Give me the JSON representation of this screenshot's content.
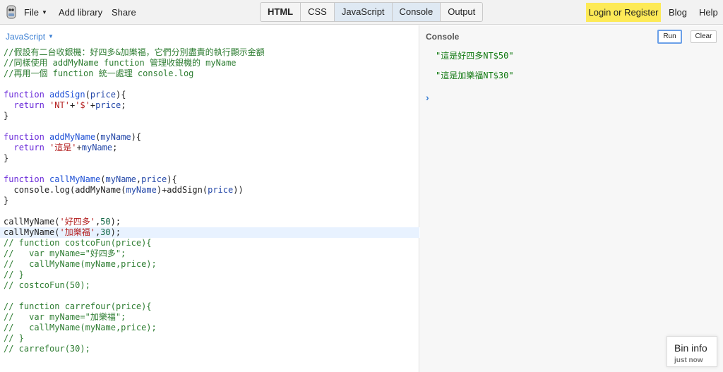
{
  "topbar": {
    "file_label": "File",
    "add_library_label": "Add library",
    "share_label": "Share",
    "tabs": [
      "HTML",
      "CSS",
      "JavaScript",
      "Console",
      "Output"
    ],
    "login_label": "Login or Register",
    "blog_label": "Blog",
    "help_label": "Help",
    "accent_color": "#fdea57"
  },
  "editor": {
    "language_label": "JavaScript",
    "lines": [
      "//假設有二台收銀機：好四多&加樂福，它們分別盡責的執行顯示金額",
      "//同樣使用 addMyName function 管理收銀機的 myName",
      "//再用一個 function 統一處理 console.log",
      "",
      "function addSign(price){",
      "  return 'NT'+'$'+price;",
      "}",
      "",
      "function addMyName(myName){",
      "  return '這是'+myName;",
      "}",
      "",
      "function callMyName(myName,price){",
      "  console.log(addMyName(myName)+addSign(price))",
      "}",
      "",
      "callMyName('好四多',50);",
      "callMyName('加樂福',30);",
      "// function costcoFun(price){",
      "//   var myName=\"好四多\";",
      "//   callMyName(myName,price);",
      "// }",
      "// costcoFun(50);",
      "",
      "// function carrefour(price){",
      "//   var myName=\"加樂福\";",
      "//   callMyName(myName,price);",
      "// }",
      "// carrefour(30);"
    ]
  },
  "console": {
    "title": "Console",
    "run_label": "Run",
    "clear_label": "Clear",
    "outputs": [
      "\"這是好四多NT$50\"",
      "\"這是加樂福NT$30\""
    ],
    "prompt": "›"
  },
  "bin_info": {
    "title": "Bin info",
    "subtitle": "just now"
  }
}
